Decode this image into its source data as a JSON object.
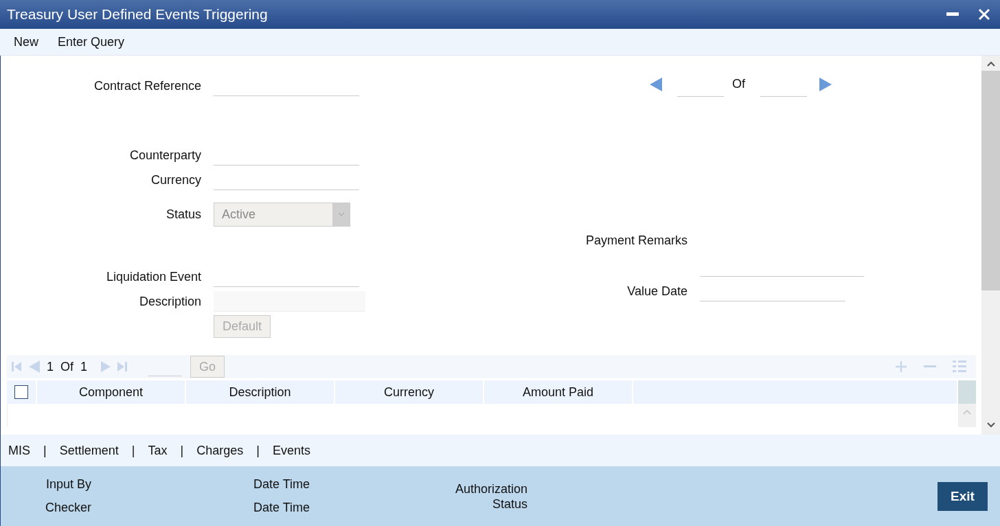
{
  "window": {
    "title": "Treasury User Defined Events Triggering"
  },
  "toolbar": [
    "New",
    "Enter Query"
  ],
  "record_nav": {
    "of": "Of"
  },
  "fields": {
    "contract_reference": {
      "label": "Contract Reference",
      "disabled": false
    },
    "counterparty": {
      "label": "Counterparty",
      "disabled": false
    },
    "currency": {
      "label": "Currency",
      "disabled": false
    },
    "status": {
      "label": "Status",
      "value": "Active",
      "disabled": true
    },
    "liquidation_event": {
      "label": "Liquidation Event",
      "disabled": false
    },
    "description": {
      "label": "Description",
      "disabled": true
    },
    "payment_remarks": {
      "label": "Payment Remarks",
      "disabled": false
    },
    "value_date": {
      "label": "Value Date",
      "disabled": false
    }
  },
  "default_button": {
    "label": "Default",
    "disabled": true
  },
  "grid": {
    "pager": {
      "current": "1",
      "of": "Of",
      "total": "1"
    },
    "go_button": {
      "label": "Go",
      "disabled": true
    },
    "select_all": {
      "checked": false
    },
    "columns": [
      "Component",
      "Description",
      "Currency",
      "Amount Paid"
    ]
  },
  "tabs": {
    "separator": "|",
    "items": [
      "MIS",
      "Settlement",
      "Tax",
      "Charges",
      "Events"
    ]
  },
  "footer": {
    "input_by": "Input By",
    "date_time_1": "Date Time",
    "checker": "Checker",
    "date_time_2": "Date Time",
    "authorization_status": "Authorization\nStatus"
  },
  "exit_button": "Exit"
}
